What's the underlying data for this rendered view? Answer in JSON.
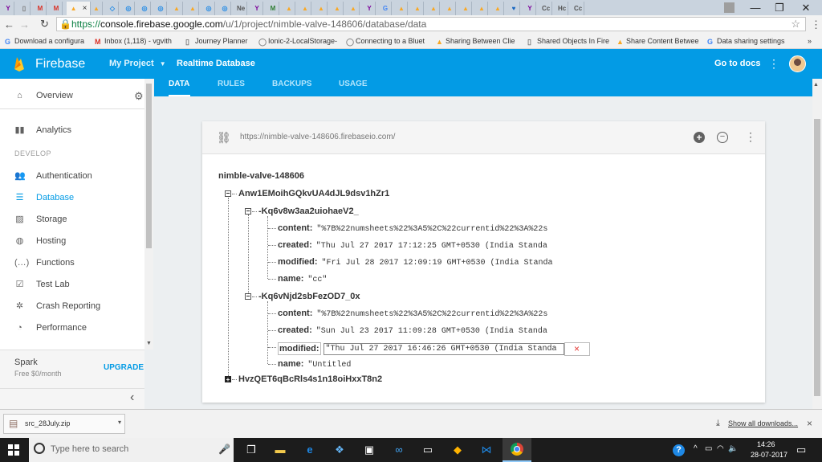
{
  "browser": {
    "tabs": [
      {
        "icon": "Y",
        "color": "#7b0099"
      },
      {
        "icon": "▯",
        "color": "#777777"
      },
      {
        "icon": "M",
        "color": "#d93025"
      },
      {
        "icon": "M",
        "color": "#d93025"
      },
      {
        "icon": "▲",
        "color": "#f9a825"
      },
      {
        "icon": "▲",
        "color": "#f9a825"
      },
      {
        "icon": "◇",
        "color": "#1e88e5"
      },
      {
        "icon": "◎",
        "color": "#1e88e5"
      },
      {
        "icon": "◎",
        "color": "#1e88e5"
      },
      {
        "icon": "◎",
        "color": "#1e88e5"
      },
      {
        "icon": "▲",
        "color": "#f9a825"
      },
      {
        "icon": "▲",
        "color": "#f9a825"
      },
      {
        "icon": "◎",
        "color": "#1e88e5"
      },
      {
        "icon": "◎",
        "color": "#1e88e5"
      },
      {
        "icon": "Ne",
        "color": "#555555"
      },
      {
        "icon": "Y",
        "color": "#7b0099"
      },
      {
        "icon": "M",
        "color": "#2e7d32"
      },
      {
        "icon": "▲",
        "color": "#f9a825"
      },
      {
        "icon": "▲",
        "color": "#f9a825"
      },
      {
        "icon": "▲",
        "color": "#f9a825"
      },
      {
        "icon": "▲",
        "color": "#f9a825"
      },
      {
        "icon": "▲",
        "color": "#f9a825"
      },
      {
        "icon": "Y",
        "color": "#7b0099"
      },
      {
        "icon": "G",
        "color": "#4285f4"
      },
      {
        "icon": "▲",
        "color": "#f9a825"
      },
      {
        "icon": "▲",
        "color": "#f9a825"
      },
      {
        "icon": "▲",
        "color": "#f9a825"
      },
      {
        "icon": "▲",
        "color": "#f9a825"
      },
      {
        "icon": "▲",
        "color": "#f9a825"
      },
      {
        "icon": "▲",
        "color": "#f9a825"
      },
      {
        "icon": "▲",
        "color": "#f9a825"
      },
      {
        "icon": "♥",
        "color": "#1565c0"
      },
      {
        "icon": "Y",
        "color": "#7b0099"
      },
      {
        "icon": "Cc",
        "color": "#555555"
      },
      {
        "icon": "Hc",
        "color": "#555555"
      },
      {
        "icon": "Cc",
        "color": "#555555"
      }
    ],
    "active_tab_close": "×",
    "url_scheme": "https://",
    "url_host": "console.firebase.google.com",
    "url_path": "/u/1/project/nimble-valve-148606/database/data",
    "bookmarks": [
      {
        "label": "Download a configura",
        "icon": "G"
      },
      {
        "label": "Inbox (1,118) - vgvith",
        "icon": "M"
      },
      {
        "label": "Journey Planner",
        "icon": "▯"
      },
      {
        "label": "Ionic-2-LocalStorage-",
        "icon": "◯"
      },
      {
        "label": "Connecting to a Bluet",
        "icon": "◯"
      },
      {
        "label": "Sharing Between Clie",
        "icon": "▲"
      },
      {
        "label": "Shared Objects In Fire",
        "icon": "▯"
      },
      {
        "label": "Share Content Betwee",
        "icon": "▲"
      },
      {
        "label": "Data sharing settings",
        "icon": "G"
      }
    ],
    "bookmarks_more": "»"
  },
  "header": {
    "product": "Firebase",
    "project": "My Project",
    "section": "Realtime Database",
    "docs": "Go to docs"
  },
  "db_tabs": [
    "DATA",
    "RULES",
    "BACKUPS",
    "USAGE"
  ],
  "sidebar": {
    "overview": "Overview",
    "analytics": "Analytics",
    "develop_header": "DEVELOP",
    "items": [
      {
        "label": "Authentication",
        "icon": "people-icon",
        "glyph": "👥"
      },
      {
        "label": "Database",
        "icon": "database-icon",
        "glyph": "☰"
      },
      {
        "label": "Storage",
        "icon": "image-icon",
        "glyph": "▨"
      },
      {
        "label": "Hosting",
        "icon": "globe-icon",
        "glyph": "◍"
      },
      {
        "label": "Functions",
        "icon": "functions-icon",
        "glyph": "(…)"
      },
      {
        "label": "Test Lab",
        "icon": "testlab-icon",
        "glyph": "☑"
      },
      {
        "label": "Crash Reporting",
        "icon": "bug-icon",
        "glyph": "✲"
      },
      {
        "label": "Performance",
        "icon": "performance-icon",
        "glyph": "◔"
      }
    ],
    "plan": "Spark",
    "plan_price": "Free $0/month",
    "upgrade": "UPGRADE",
    "collapse": "‹"
  },
  "database": {
    "url": "https://nimble-valve-148606.firebaseio.com/",
    "root": "nimble-valve-148606",
    "child1": "Anw1EMoihGQkvUA4dJL9dsv1hZr1",
    "entries": [
      {
        "key": "-Kq6v8w3aa2uiohaeV2_",
        "fields": [
          {
            "name": "content:",
            "value": "\"%7B%22numsheets%22%3A5%2C%22currentid%22%3A%22s"
          },
          {
            "name": "created:",
            "value": "\"Thu Jul 27 2017 17:12:25 GMT+0530 (India Standa"
          },
          {
            "name": "modified:",
            "value": "\"Fri Jul 28 2017 12:09:19 GMT+0530 (India Standa"
          },
          {
            "name": "name:",
            "value": "\"cc\""
          }
        ]
      },
      {
        "key": "-Kq6vNjd2sbFezOD7_0x",
        "fields": [
          {
            "name": "content:",
            "value": "\"%7B%22numsheets%22%3A5%2C%22currentid%22%3A%22s"
          },
          {
            "name": "created:",
            "value": "\"Sun Jul 23 2017 11:09:28 GMT+0530 (India Standa"
          },
          {
            "name": "modified:",
            "value": "\"Thu Jul 27 2017 16:46:26 GMT+0530 (India Standa"
          },
          {
            "name": "name:",
            "value": "\"Untitled"
          }
        ]
      }
    ],
    "child2": "HvzQET6qBcRls4s1n18oiHxxT8n2",
    "edit_cancel": "×"
  },
  "download": {
    "file": "src_28July.zip",
    "show_all": "Show all downloads...",
    "close": "×"
  },
  "taskbar": {
    "search_placeholder": "Type here to search",
    "time": "14:26",
    "date": "28-07-2017"
  }
}
